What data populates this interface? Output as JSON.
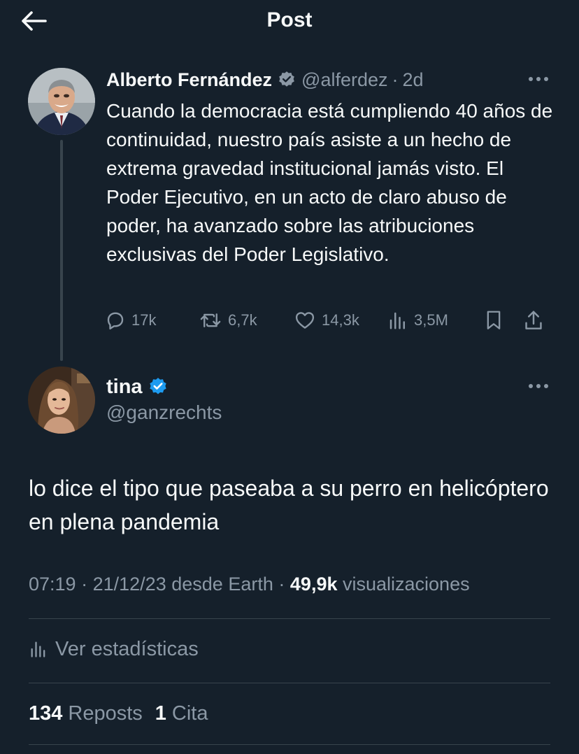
{
  "header": {
    "title": "Post",
    "back_icon": "arrow-left-icon"
  },
  "quoted_post": {
    "author_name": "Alberto Fernández",
    "handle": "@alferdez",
    "separator": "·",
    "time_ago": "2d",
    "verified_badge_color": "#8b98a5",
    "text": "Cuando la democracia está cumpliendo 40 años de continuidad, nuestro país asiste a un hecho de extrema gravedad institucional jamás visto. El Poder Ejecutivo, en un acto de claro abuso de poder, ha avanzado sobre las atribuciones exclusivas del Poder Legislativo.",
    "actions": {
      "replies": "17k",
      "reposts": "6,7k",
      "likes": "14,3k",
      "views": "3,5M"
    }
  },
  "main_post": {
    "author_name": "tina",
    "handle": "@ganzrechts",
    "verified_badge_color": "#1d9bf0",
    "text": "lo dice el tipo que paseaba a su perro en helicóptero en plena pandemia",
    "meta": {
      "time": "07:19",
      "separator": "·",
      "date": "21/12/23",
      "source_prefix": "desde",
      "source": "Earth",
      "views_count": "49,9k",
      "views_label": "visualizaciones"
    },
    "view_stats_label": "Ver estadísticas",
    "reposts_count": "134",
    "reposts_label": "Reposts",
    "quotes_count": "1",
    "quotes_label": "Cita"
  },
  "colors": {
    "background": "#15202b",
    "text_primary": "#f7f9f9",
    "text_secondary": "#8b98a5",
    "divider": "#38444d",
    "accent": "#1d9bf0"
  }
}
